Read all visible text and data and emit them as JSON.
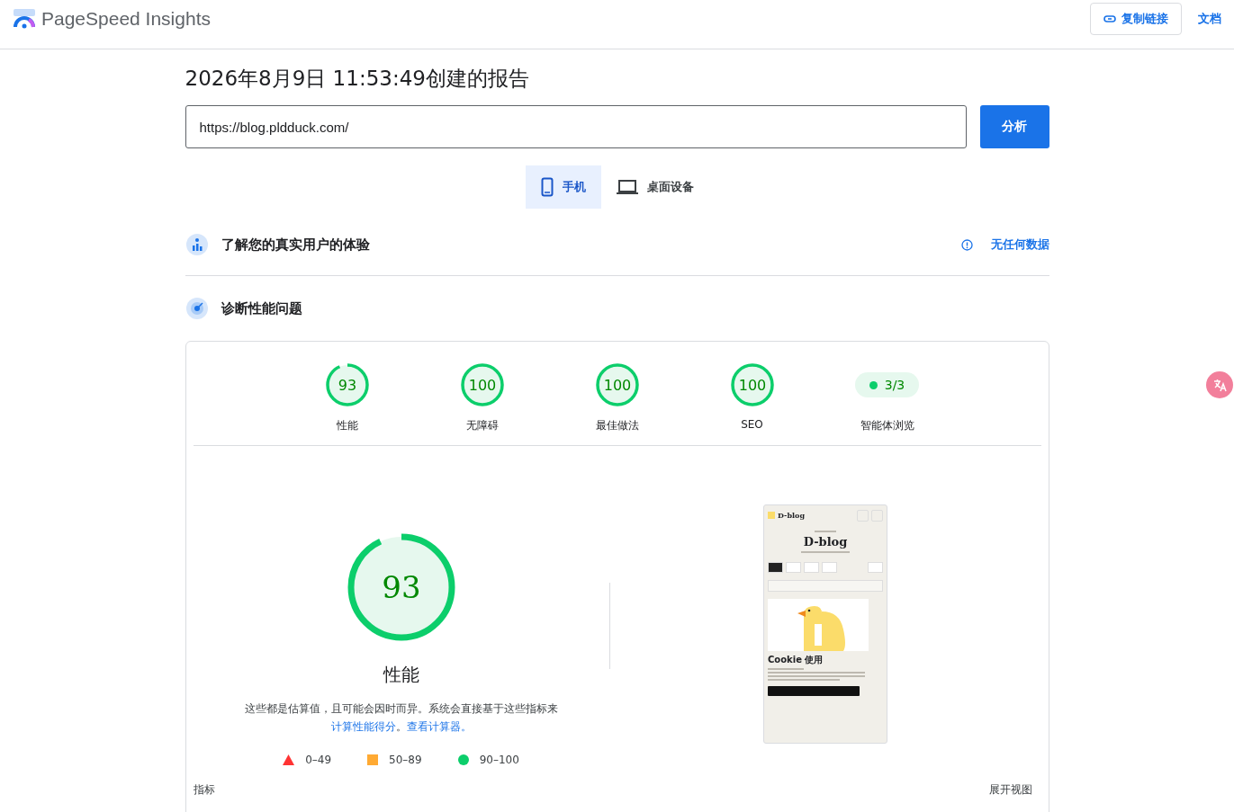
{
  "header": {
    "title": "PageSpeed Insights",
    "actions": [
      {
        "label": "复制链接",
        "kind": "outlined"
      },
      {
        "label": "文档",
        "kind": "text"
      }
    ]
  },
  "report_title": "2026年8月9日 11:53:49创建的报告",
  "url_field": {
    "value": "https://blog.pldduck.com/"
  },
  "analyze_button": "分析",
  "device_tabs": [
    {
      "label": "手机",
      "kind": "phone",
      "selected": true
    },
    {
      "label": "桌面设备",
      "kind": "laptop",
      "selected": false
    }
  ],
  "field_data": {
    "title": "了解您的真实用户的体验",
    "status": "无任何数据"
  },
  "diagnose": {
    "title": "诊断性能问题"
  },
  "scores": [
    {
      "kind": "gauge",
      "value": "93",
      "label": "性能",
      "level": 0.93
    },
    {
      "kind": "gauge",
      "value": "100",
      "label": "无障碍",
      "level": 1
    },
    {
      "kind": "gauge",
      "value": "100",
      "label": "最佳做法",
      "level": 1
    },
    {
      "kind": "gauge",
      "value": "100",
      "label": "SEO",
      "level": 1
    },
    {
      "kind": "pill",
      "value": "3/3",
      "label": "智能体浏览"
    }
  ],
  "main_score": {
    "value": "93",
    "label": "性能",
    "level": 0.93
  },
  "note": [
    {
      "kind": "text",
      "text": "这些都是估算值，且可能会因时而异。系统会直接基于这些指标来"
    },
    {
      "kind": "link",
      "text": "计算性能得分"
    },
    {
      "kind": "text",
      "text": "。"
    },
    {
      "kind": "link",
      "text": "查看计算器。"
    }
  ],
  "legend": [
    {
      "kind": "triangle",
      "label": "0–49",
      "color": "#ff3333"
    },
    {
      "kind": "square",
      "label": "50–89",
      "color": "#ffaa33"
    },
    {
      "kind": "circle",
      "label": "90–100",
      "color": "#0cce6b"
    }
  ],
  "thumbnail": {
    "site_name": "D-blog",
    "hero_title": "D-blog",
    "cookie_title": "Cookie 使用"
  },
  "metrics": {
    "title": "指标",
    "expand": "展开视图"
  }
}
